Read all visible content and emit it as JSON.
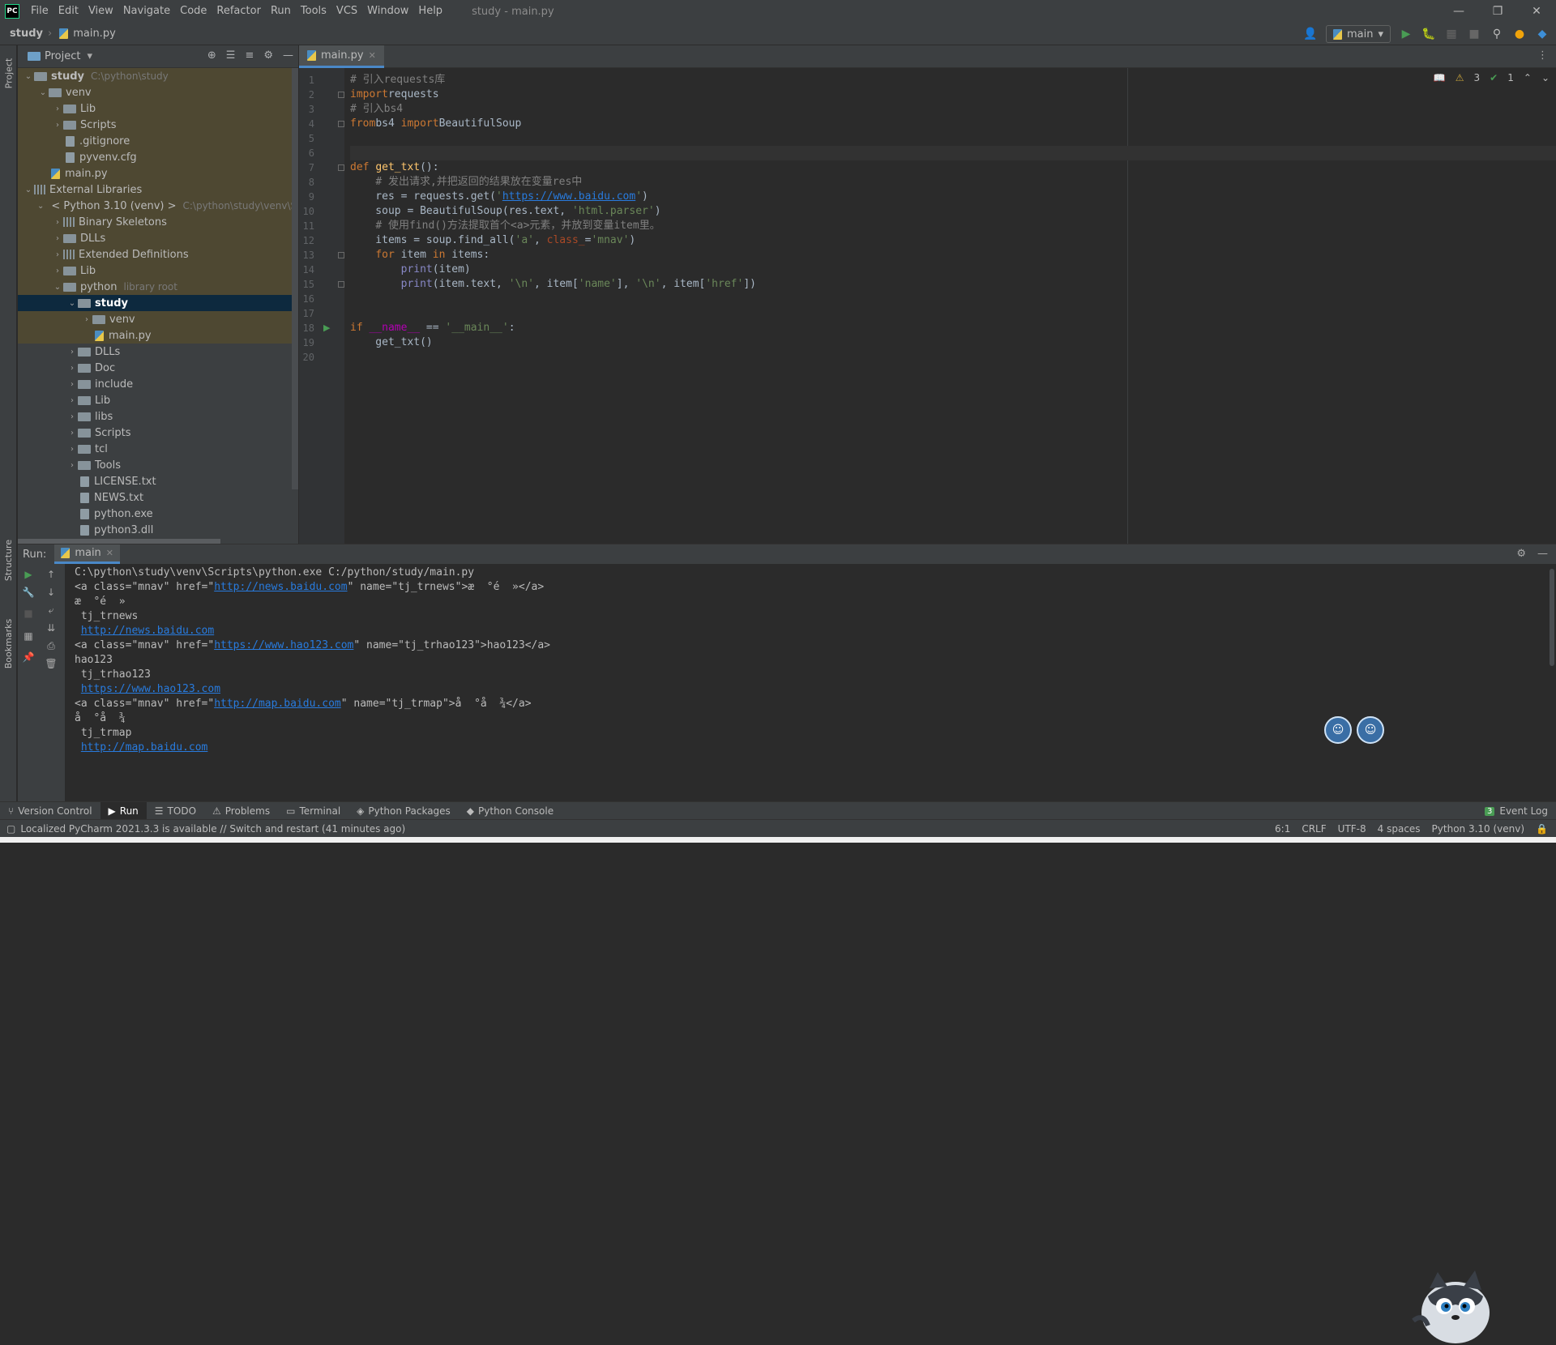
{
  "menubar": {
    "logo": "PC",
    "items": [
      "File",
      "Edit",
      "View",
      "Navigate",
      "Code",
      "Refactor",
      "Run",
      "Tools",
      "VCS",
      "Window",
      "Help"
    ],
    "title": "study - main.py"
  },
  "navbar": {
    "project": "study",
    "file": "main.py",
    "run_config": "main"
  },
  "project_panel": {
    "title": "Project",
    "tree": [
      {
        "label": "study",
        "hint": "C:\\python\\study",
        "depth": 0,
        "arrow": "v",
        "icon": "folder",
        "bold": true,
        "hl": true
      },
      {
        "label": "venv",
        "depth": 1,
        "arrow": "v",
        "icon": "folder",
        "hl": true
      },
      {
        "label": "Lib",
        "depth": 2,
        "arrow": ">",
        "icon": "folder",
        "hl": true
      },
      {
        "label": "Scripts",
        "depth": 2,
        "arrow": ">",
        "icon": "folder",
        "hl": true
      },
      {
        "label": ".gitignore",
        "depth": 2,
        "arrow": "",
        "icon": "file",
        "hl": true
      },
      {
        "label": "pyvenv.cfg",
        "depth": 2,
        "arrow": "",
        "icon": "file",
        "hl": true
      },
      {
        "label": "main.py",
        "depth": 1,
        "arrow": "",
        "icon": "py",
        "hl": true
      },
      {
        "label": "External Libraries",
        "depth": 0,
        "arrow": "v",
        "icon": "lib",
        "hl": true
      },
      {
        "label": "< Python 3.10 (venv) >",
        "hint": "C:\\python\\study\\venv\\Scr",
        "depth": 1,
        "arrow": "v",
        "icon": "py",
        "hl": true
      },
      {
        "label": "Binary Skeletons",
        "depth": 2,
        "arrow": ">",
        "icon": "lib",
        "hl": true
      },
      {
        "label": "DLLs",
        "depth": 2,
        "arrow": ">",
        "icon": "folder",
        "hl": true
      },
      {
        "label": "Extended Definitions",
        "depth": 2,
        "arrow": ">",
        "icon": "lib",
        "hl": true
      },
      {
        "label": "Lib",
        "depth": 2,
        "arrow": ">",
        "icon": "folder",
        "hl": true
      },
      {
        "label": "python",
        "hint": "library root",
        "depth": 2,
        "arrow": "v",
        "icon": "folder",
        "hl": true
      },
      {
        "label": "study",
        "depth": 3,
        "arrow": "v",
        "icon": "folder",
        "bold": true,
        "sel": true
      },
      {
        "label": "venv",
        "depth": 4,
        "arrow": ">",
        "icon": "folder",
        "hl": true
      },
      {
        "label": "main.py",
        "depth": 4,
        "arrow": "",
        "icon": "py",
        "hl": true
      },
      {
        "label": "DLLs",
        "depth": 3,
        "arrow": ">",
        "icon": "folder"
      },
      {
        "label": "Doc",
        "depth": 3,
        "arrow": ">",
        "icon": "folder"
      },
      {
        "label": "include",
        "depth": 3,
        "arrow": ">",
        "icon": "folder"
      },
      {
        "label": "Lib",
        "depth": 3,
        "arrow": ">",
        "icon": "folder"
      },
      {
        "label": "libs",
        "depth": 3,
        "arrow": ">",
        "icon": "folder"
      },
      {
        "label": "Scripts",
        "depth": 3,
        "arrow": ">",
        "icon": "folder"
      },
      {
        "label": "tcl",
        "depth": 3,
        "arrow": ">",
        "icon": "folder"
      },
      {
        "label": "Tools",
        "depth": 3,
        "arrow": ">",
        "icon": "folder"
      },
      {
        "label": "LICENSE.txt",
        "depth": 3,
        "arrow": "",
        "icon": "file"
      },
      {
        "label": "NEWS.txt",
        "depth": 3,
        "arrow": "",
        "icon": "file"
      },
      {
        "label": "python.exe",
        "depth": 3,
        "arrow": "",
        "icon": "file"
      },
      {
        "label": "python3.dll",
        "depth": 3,
        "arrow": "",
        "icon": "file"
      }
    ]
  },
  "editor": {
    "tab": "main.py",
    "inspections": {
      "warnings": "3",
      "ok": "1"
    },
    "lines": [
      [
        [
          "cm",
          "# 引入requests库"
        ]
      ],
      [
        [
          "kw",
          "import"
        ],
        [
          "",
          "requests"
        ]
      ],
      [
        [
          "cm",
          "# 引入bs4"
        ]
      ],
      [
        [
          "kw",
          "from"
        ],
        [
          "",
          "bs4 "
        ],
        [
          "kw",
          "import"
        ],
        [
          "",
          "BeautifulSoup"
        ]
      ],
      [],
      [],
      [
        [
          "kw",
          "def "
        ],
        [
          "fn",
          "get_txt"
        ],
        [
          "",
          "():"
        ]
      ],
      [
        [
          "",
          "    "
        ],
        [
          "cm",
          "# 发出请求,并把返回的结果放在变量res中"
        ]
      ],
      [
        [
          "",
          "    res = requests.get("
        ],
        [
          "st",
          "'"
        ],
        [
          "ur",
          "https://www.baidu.com"
        ],
        [
          "st",
          "'"
        ],
        [
          "",
          ")"
        ]
      ],
      [
        [
          "",
          "    soup = BeautifulSoup(res.text, "
        ],
        [
          "st",
          "'html.parser'"
        ],
        [
          "",
          ")"
        ]
      ],
      [
        [
          "",
          "    "
        ],
        [
          "cm",
          "# 使用find()方法提取首个<a>元素，并放到变量item里。"
        ]
      ],
      [
        [
          "",
          "    items = soup.find_all("
        ],
        [
          "st",
          "'a'"
        ],
        [
          "",
          ", "
        ],
        [
          "pa",
          "class_"
        ],
        [
          "",
          "="
        ],
        [
          "st",
          "'mnav'"
        ],
        [
          "",
          ")"
        ]
      ],
      [
        [
          "",
          "    "
        ],
        [
          "kw",
          "for "
        ],
        [
          "",
          "item "
        ],
        [
          "kw",
          "in "
        ],
        [
          "",
          "items:"
        ]
      ],
      [
        [
          "",
          "        "
        ],
        [
          "bi",
          "print"
        ],
        [
          "",
          "(item)"
        ]
      ],
      [
        [
          "",
          "        "
        ],
        [
          "bi",
          "print"
        ],
        [
          "",
          "(item.text, "
        ],
        [
          "st",
          "'\\n'"
        ],
        [
          "",
          ", item["
        ],
        [
          "st",
          "'name'"
        ],
        [
          "",
          "], "
        ],
        [
          "st",
          "'\\n'"
        ],
        [
          "",
          ", item["
        ],
        [
          "st",
          "'href'"
        ],
        [
          "",
          "])"
        ]
      ],
      [],
      [],
      [
        [
          "kw",
          "if "
        ],
        [
          "ma",
          "__name__"
        ],
        [
          "",
          " == "
        ],
        [
          "st",
          "'__main__'"
        ],
        [
          "",
          ":"
        ]
      ],
      [
        [
          "",
          "    get_txt()"
        ]
      ],
      []
    ],
    "line_numbers": [
      "1",
      "2",
      "3",
      "4",
      "5",
      "6",
      "7",
      "8",
      "9",
      "10",
      "11",
      "12",
      "13",
      "14",
      "15",
      "16",
      "17",
      "18",
      "19",
      "20"
    ]
  },
  "run": {
    "label": "Run:",
    "tab": "main",
    "console": [
      [
        [
          "",
          "C:\\python\\study\\venv\\Scripts\\python.exe C:/python/study/main.py"
        ]
      ],
      [
        [
          "",
          "<a class=\"mnav\" href=\""
        ],
        [
          "ur",
          "http://news.baidu.com"
        ],
        [
          "",
          "\" name=\"tj_trnews\">æ  °é  »</a>"
        ]
      ],
      [
        [
          "",
          "æ  °é  »"
        ]
      ],
      [
        [
          "",
          " tj_trnews"
        ]
      ],
      [
        [
          "",
          " "
        ],
        [
          "ur",
          "http://news.baidu.com"
        ]
      ],
      [
        [
          "",
          "<a class=\"mnav\" href=\""
        ],
        [
          "ur",
          "https://www.hao123.com"
        ],
        [
          "",
          "\" name=\"tj_trhao123\">hao123</a>"
        ]
      ],
      [
        [
          "",
          "hao123"
        ]
      ],
      [
        [
          "",
          " tj_trhao123"
        ]
      ],
      [
        [
          "",
          " "
        ],
        [
          "ur",
          "https://www.hao123.com"
        ]
      ],
      [
        [
          "",
          "<a class=\"mnav\" href=\""
        ],
        [
          "ur",
          "http://map.baidu.com"
        ],
        [
          "",
          "\" name=\"tj_trmap\">å  °å  ¾</a>"
        ]
      ],
      [
        [
          "",
          "å  °å  ¾"
        ]
      ],
      [
        [
          "",
          " tj_trmap"
        ]
      ],
      [
        [
          "",
          " "
        ],
        [
          "ur",
          "http://map.baidu.com"
        ]
      ]
    ]
  },
  "bottom_tools": [
    "Version Control",
    "Run",
    "TODO",
    "Problems",
    "Terminal",
    "Python Packages",
    "Python Console"
  ],
  "event_log": {
    "count": "3",
    "label": "Event Log"
  },
  "status": {
    "message": "Localized PyCharm 2021.3.3 is available // Switch and restart (41 minutes ago)",
    "position": "6:1",
    "line_sep": "CRLF",
    "encoding": "UTF-8",
    "indent": "4 spaces",
    "interpreter": "Python 3.10 (venv)"
  },
  "left_strip": {
    "project": "Project",
    "structure": "Structure",
    "bookmarks": "Bookmarks"
  }
}
